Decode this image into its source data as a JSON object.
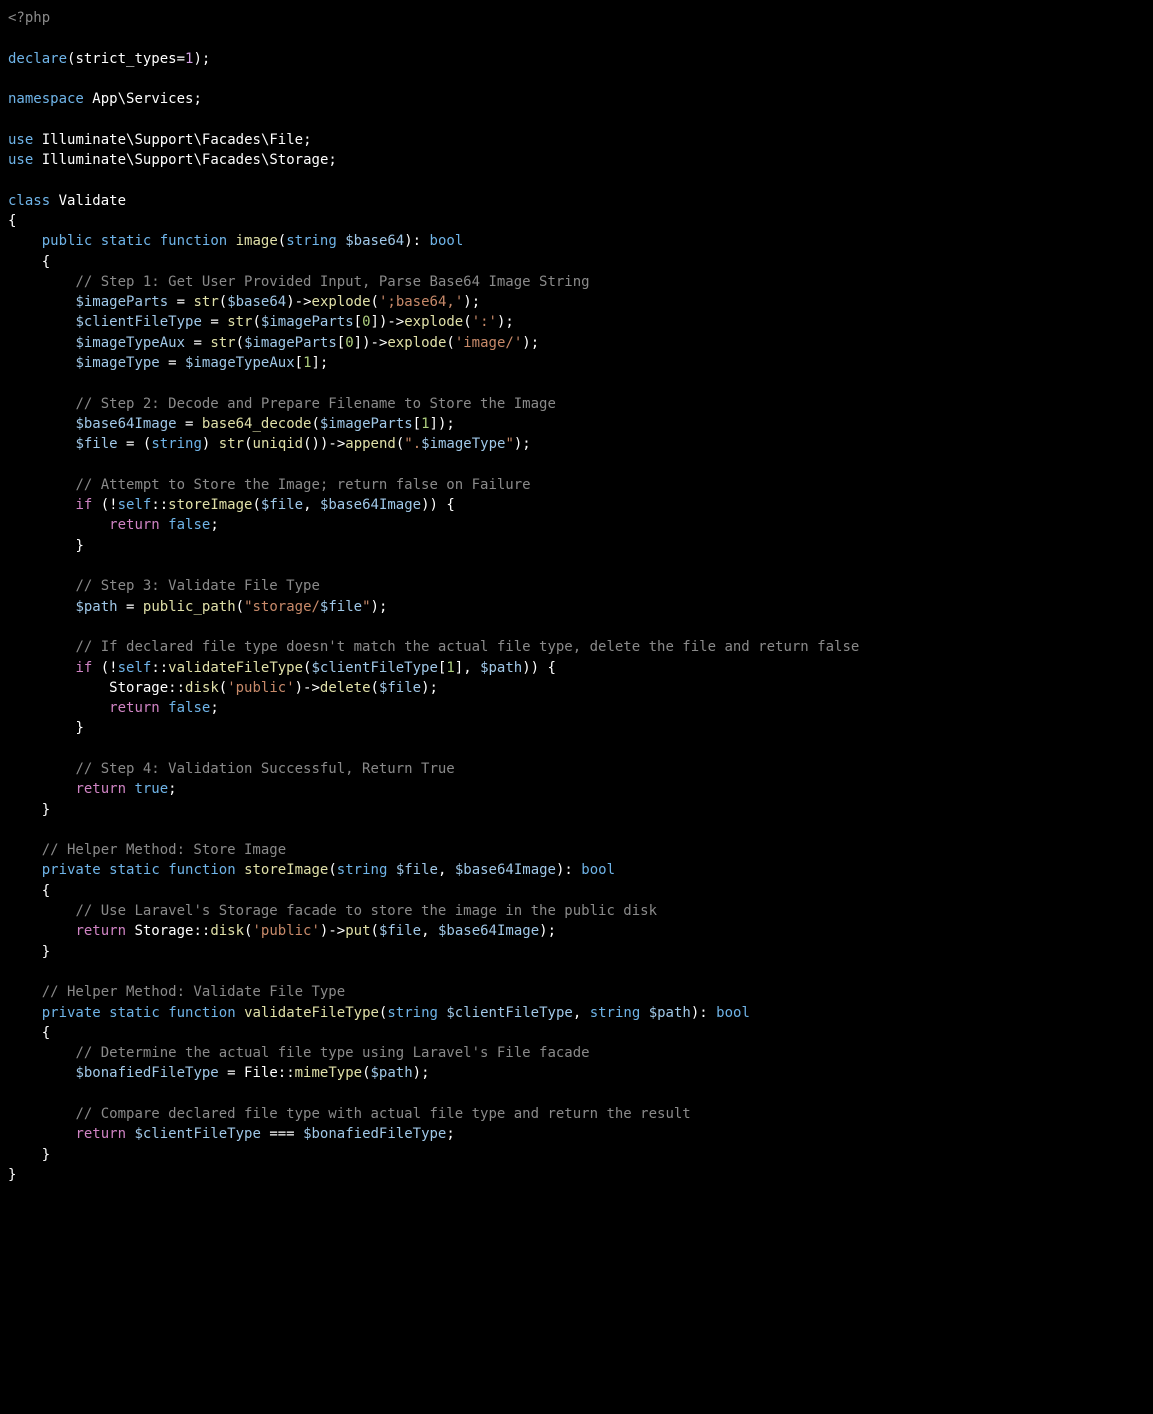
{
  "code": {
    "open_tag": "<?php",
    "declare_kw": "declare",
    "strict": "strict_types",
    "one": "1",
    "namespace_kw": "namespace",
    "ns_app": "App",
    "ns_services": "Services",
    "use_kw": "use",
    "use1_p1": "Illuminate",
    "use1_p2": "Support",
    "use1_p3": "Facades",
    "use1_p4": "File",
    "use2_p4": "Storage",
    "class_kw": "class",
    "class_name": "Validate",
    "public_kw": "public",
    "private_kw": "private",
    "static_kw": "static",
    "function_kw": "function",
    "return_kw": "return",
    "if_kw": "if",
    "self_kw": "self",
    "string_t": "string",
    "bool_t": "bool",
    "true_t": "true",
    "false_t": "false",
    "fn_image": "image",
    "v_base64": "$base64",
    "c_step1": "// Step 1: Get User Provided Input, Parse Base64 Image String",
    "v_imageParts": "$imageParts",
    "fn_str": "str",
    "fn_explode": "explode",
    "s_b64": "';base64,'",
    "v_clientFileType": "$clientFileType",
    "idx0": "0",
    "s_colon": "':'",
    "v_imageTypeAux": "$imageTypeAux",
    "s_imgslash": "'image/'",
    "v_imageType": "$imageType",
    "idx1": "1",
    "c_step2": "// Step 2: Decode and Prepare Filename to Store the Image",
    "v_base64Image": "$base64Image",
    "fn_b64dec": "base64_decode",
    "v_file": "$file",
    "fn_uniqid": "uniqid",
    "fn_append": "append",
    "s_dot": "\".",
    "s_dot_end": "\"",
    "c_attempt": "// Attempt to Store the Image; return false on Failure",
    "fn_storeImage": "storeImage",
    "c_step3": "// Step 3: Validate File Type",
    "v_path": "$path",
    "fn_public_path": "public_path",
    "s_storage_a": "\"storage/",
    "s_storage_b": "\"",
    "c_ifdecl": "// If declared file type doesn't match the actual file type, delete the file and return false",
    "fn_validateFileType": "validateFileType",
    "cls_Storage": "Storage",
    "fn_disk": "disk",
    "s_public": "'public'",
    "fn_delete": "delete",
    "c_step4": "// Step 4: Validation Successful, Return True",
    "c_helper1": "// Helper Method: Store Image",
    "c_uselaravel": "// Use Laravel's Storage facade to store the image in the public disk",
    "fn_put": "put",
    "c_helper2": "// Helper Method: Validate File Type",
    "c_determine": "// Determine the actual file type using Laravel's File facade",
    "v_bonafied": "$bonafiedFileType",
    "cls_File": "File",
    "fn_mimeType": "mimeType",
    "c_compare": "// Compare declared file type with actual file type and return the result"
  }
}
